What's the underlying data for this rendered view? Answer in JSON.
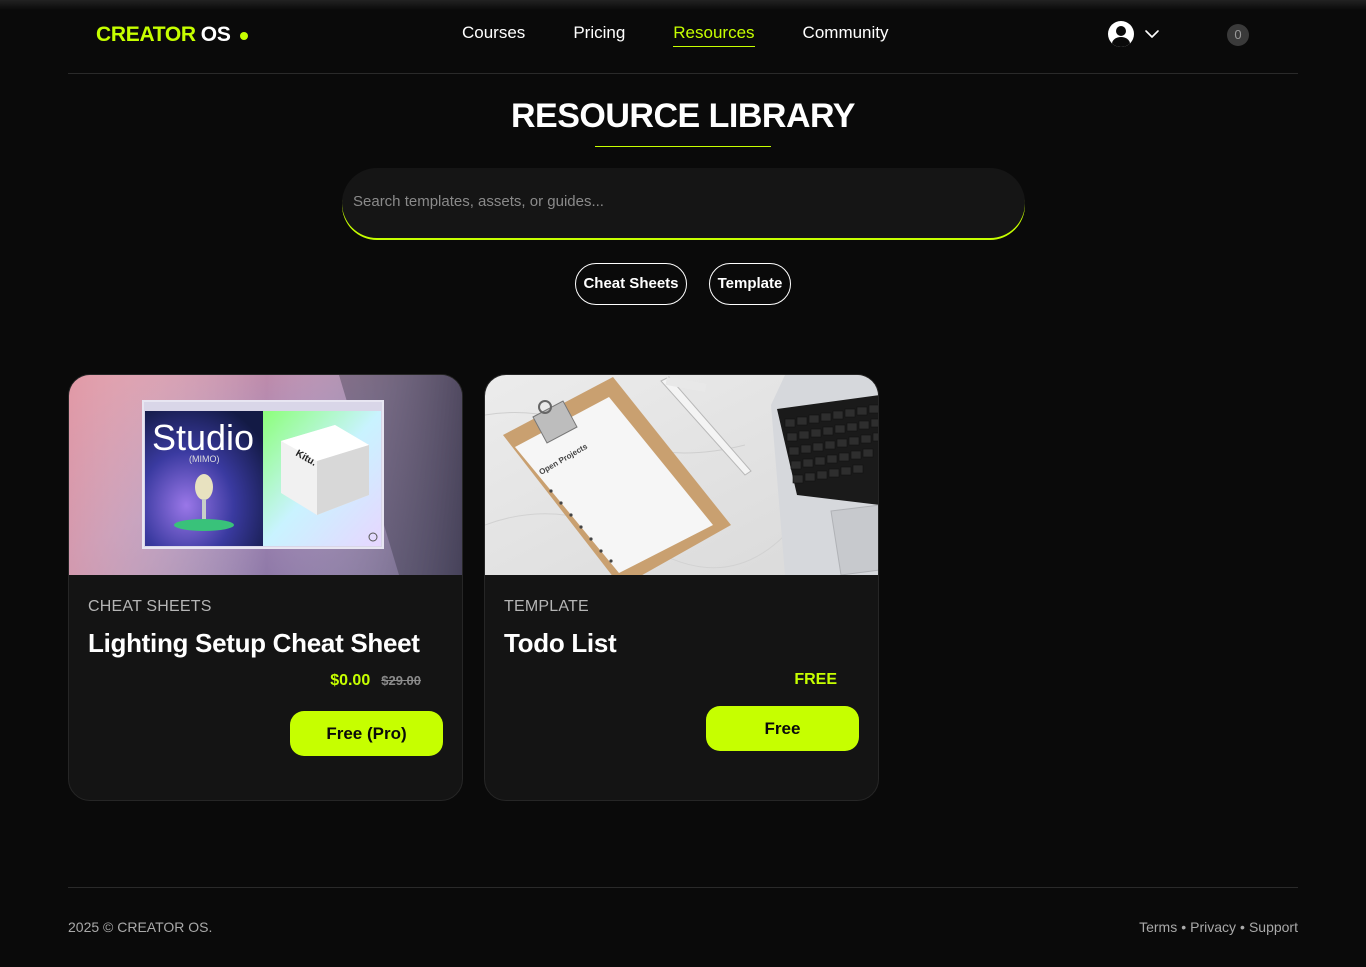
{
  "brand": {
    "name_part1": "CREATOR",
    "name_part2": "OS",
    "accent": "#c6ff00"
  },
  "nav": {
    "items": [
      {
        "label": "Courses"
      },
      {
        "label": "Pricing"
      },
      {
        "label": "Resources",
        "active": true
      },
      {
        "label": "Community"
      }
    ]
  },
  "user": {
    "avatar_icon": "user-circle-icon",
    "menu_icon": "chevron-down-icon"
  },
  "cart": {
    "count": "0"
  },
  "page": {
    "title": "RESOURCE LIBRARY"
  },
  "search": {
    "placeholder": "Search templates, assets, or guides...",
    "value": ""
  },
  "filters": [
    {
      "label": "Cheat Sheets"
    },
    {
      "label": "Template"
    }
  ],
  "cards": [
    {
      "category": "CHEAT SHEETS",
      "title": "Lighting Setup Cheat Sheet",
      "price": "$0.00",
      "old_price": "$29.00",
      "button": "Free (Pro)",
      "thumb_text": {
        "headline": "Studio",
        "sub": "(MIMO)",
        "box": "Kitu."
      }
    },
    {
      "category": "TEMPLATE",
      "title": "Todo List",
      "price_label": "FREE",
      "button": "Free",
      "thumb_text": {
        "paper": "Open Projects"
      }
    }
  ],
  "footer": {
    "copyright": "2025 © CREATOR OS.",
    "links": [
      {
        "label": "Terms"
      },
      {
        "label": "Privacy"
      },
      {
        "label": "Support"
      }
    ],
    "separator": "•"
  }
}
